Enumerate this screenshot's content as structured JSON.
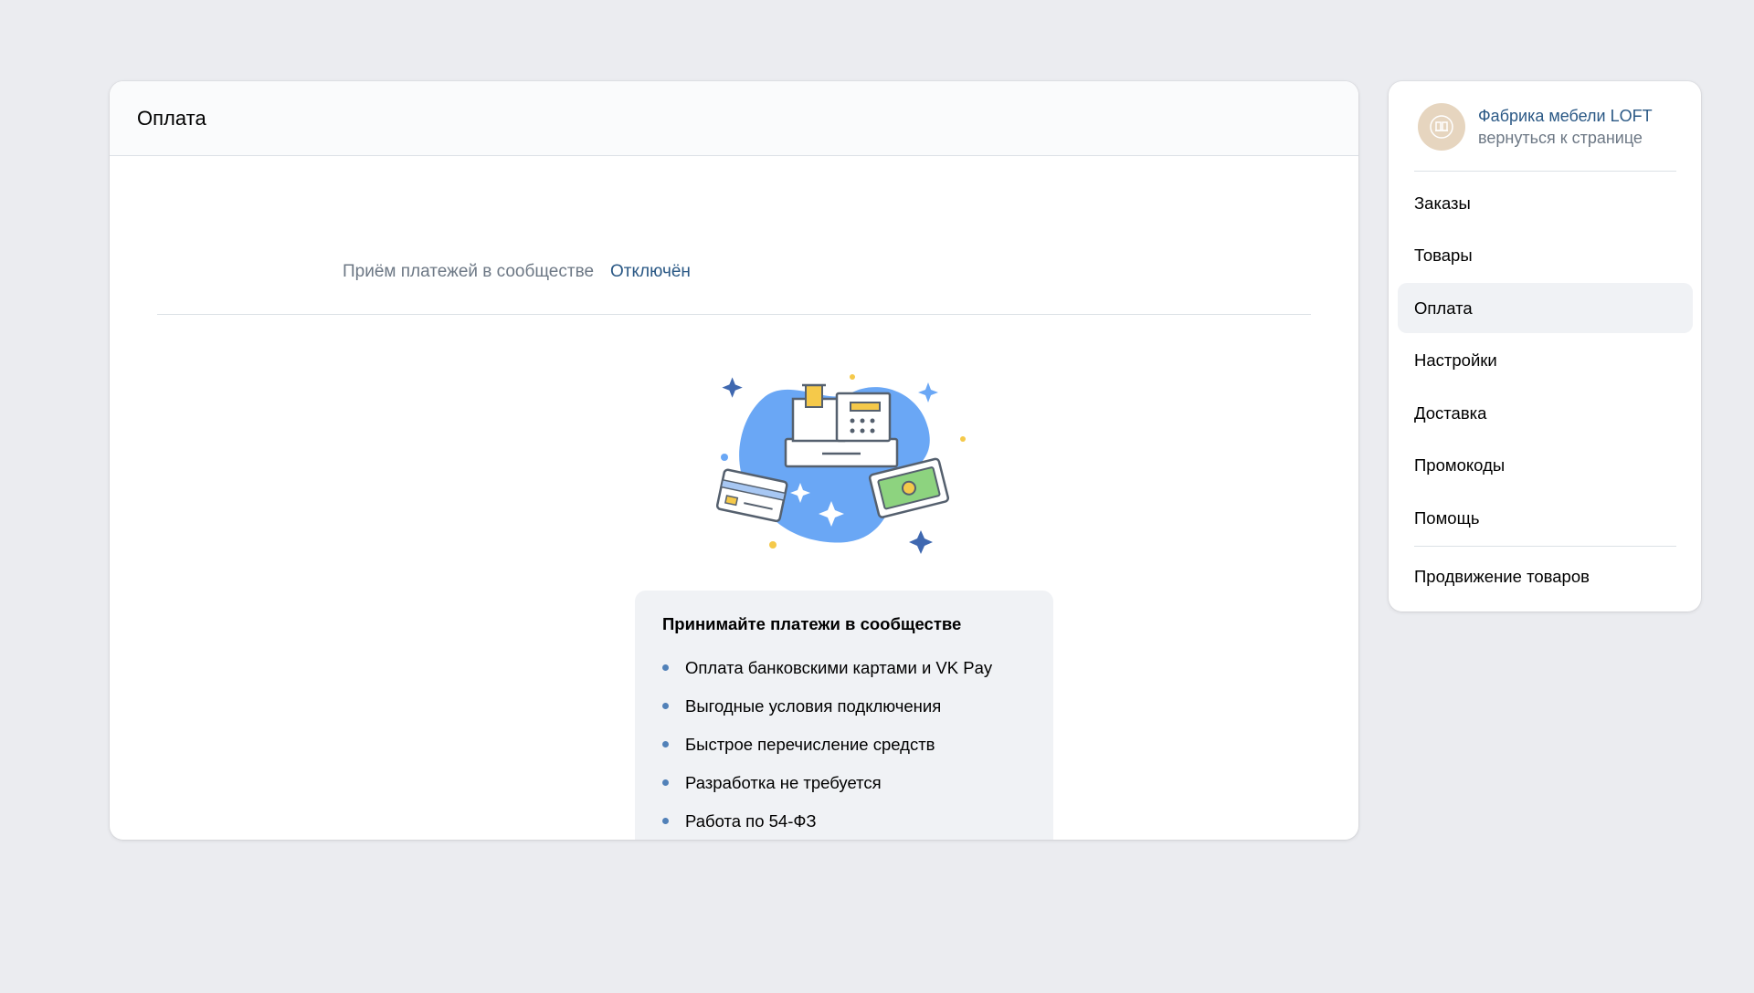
{
  "page": {
    "title": "Оплата"
  },
  "payments": {
    "label": "Приём платежей в сообществе",
    "status": "Отключён"
  },
  "promo": {
    "title": "Принимайте платежи в сообществе",
    "items": [
      "Оплата банковскими картами и VK Pay",
      "Выгодные условия подключения",
      "Быстрое перечисление средств",
      "Разработка не требуется",
      "Работа по 54-ФЗ"
    ]
  },
  "sidebar": {
    "group_name": "Фабрика мебели LOFT",
    "back_link": "вернуться к странице",
    "items": [
      {
        "label": "Заказы",
        "active": false
      },
      {
        "label": "Товары",
        "active": false
      },
      {
        "label": "Оплата",
        "active": true
      },
      {
        "label": "Настройки",
        "active": false
      },
      {
        "label": "Доставка",
        "active": false
      },
      {
        "label": "Промокоды",
        "active": false
      },
      {
        "label": "Помощь",
        "active": false
      }
    ],
    "extra_item": "Продвижение товаров"
  },
  "colors": {
    "background": "#ebecf0",
    "link": "#2a5885",
    "muted": "#6d7885",
    "accent_blob": "#6aa7f5",
    "active_item": "#f0f2f5"
  },
  "icons": {
    "illustration": "cash-register-illustration-icon",
    "avatar": "loft-logo-icon",
    "bullet": "bullet-dot-icon"
  }
}
